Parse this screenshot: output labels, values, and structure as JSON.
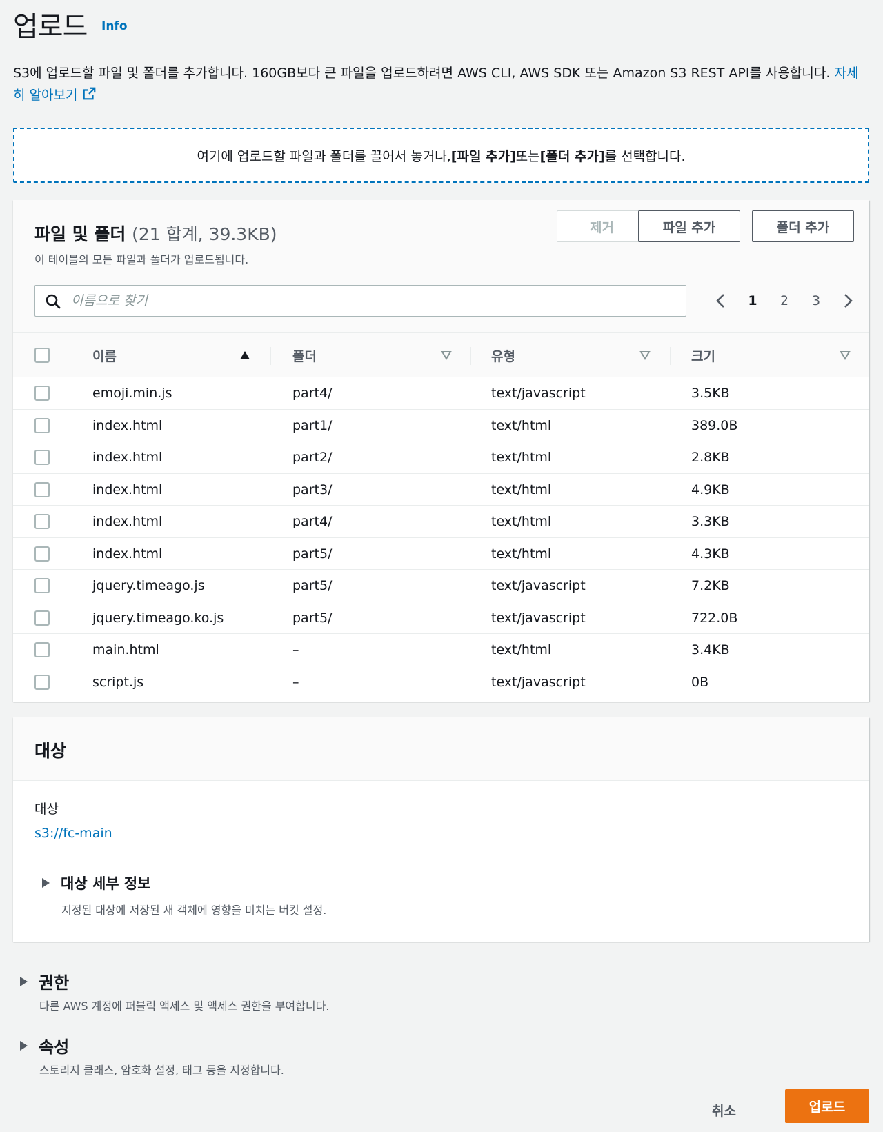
{
  "header": {
    "title": "업로드",
    "info_label": "Info",
    "description": "S3에 업로드할 파일 및 폴더를 추가합니다. 160GB보다 큰 파일을 업로드하려면 AWS CLI, AWS SDK 또는 Amazon S3 REST API를 사용합니다.",
    "learn_more": "자세히 알아보기"
  },
  "dropzone": {
    "text_before": "여기에 업로드할 파일과 폴더를 끌어서 놓거나, ",
    "add_files": "[파일 추가]",
    "middle": " 또는 ",
    "add_folder": "[폴더 추가]",
    "text_after": "를 선택합니다."
  },
  "files_panel": {
    "title": "파일 및 폴더",
    "count": "(21 합계, 39.3KB)",
    "subtitle": "이 테이블의 모든 파일과 폴더가 업로드됩니다.",
    "remove_label": "제거",
    "add_files_label": "파일 추가",
    "add_folder_label": "폴더 추가",
    "search_placeholder": "이름으로 찾기",
    "pages": [
      "1",
      "2",
      "3"
    ],
    "current_page": "1",
    "columns": [
      "이름",
      "폴더",
      "유형",
      "크기"
    ],
    "rows": [
      {
        "name": "emoji.min.js",
        "folder": "part4/",
        "type": "text/javascript",
        "size": "3.5KB"
      },
      {
        "name": "index.html",
        "folder": "part1/",
        "type": "text/html",
        "size": "389.0B"
      },
      {
        "name": "index.html",
        "folder": "part2/",
        "type": "text/html",
        "size": "2.8KB"
      },
      {
        "name": "index.html",
        "folder": "part3/",
        "type": "text/html",
        "size": "4.9KB"
      },
      {
        "name": "index.html",
        "folder": "part4/",
        "type": "text/html",
        "size": "3.3KB"
      },
      {
        "name": "index.html",
        "folder": "part5/",
        "type": "text/html",
        "size": "4.3KB"
      },
      {
        "name": "jquery.timeago.js",
        "folder": "part5/",
        "type": "text/javascript",
        "size": "7.2KB"
      },
      {
        "name": "jquery.timeago.ko.js",
        "folder": "part5/",
        "type": "text/javascript",
        "size": "722.0B"
      },
      {
        "name": "main.html",
        "folder": "–",
        "type": "text/html",
        "size": "3.4KB"
      },
      {
        "name": "script.js",
        "folder": "–",
        "type": "text/javascript",
        "size": "0B"
      }
    ]
  },
  "destination": {
    "title": "대상",
    "label": "대상",
    "value": "s3://fc-main",
    "details_title": "대상 세부 정보",
    "details_desc": "지정된 대상에 저장된 새 객체에 영향을 미치는 버킷 설정."
  },
  "permissions": {
    "title": "권한",
    "desc": "다른 AWS 계정에 퍼블릭 액세스 및 액세스 권한을 부여합니다."
  },
  "properties": {
    "title": "속성",
    "desc": "스토리지 클래스, 암호화 설정, 태그 등을 지정합니다."
  },
  "footer": {
    "cancel_label": "취소",
    "upload_label": "업로드"
  },
  "colors": {
    "link": "#0073bb",
    "primary_button": "#ec7211",
    "text": "#16191f",
    "muted": "#545b64"
  }
}
